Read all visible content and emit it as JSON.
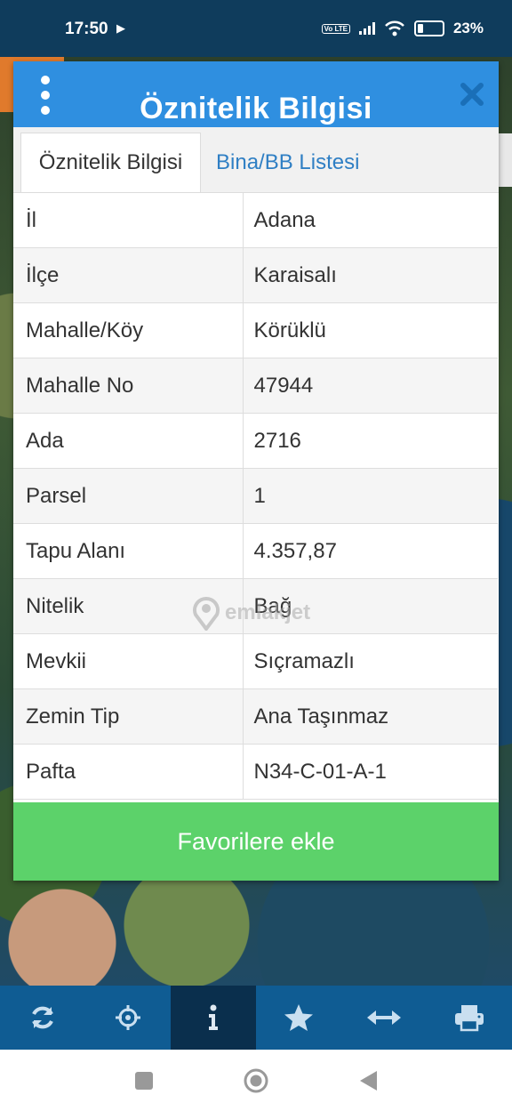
{
  "status_bar": {
    "time": "17:50",
    "volte_label": "Vo LTE",
    "battery_percent": "23%"
  },
  "modal": {
    "title": "Öznitelik Bilgisi",
    "tabs": [
      {
        "label": "Öznitelik Bilgisi",
        "active": true
      },
      {
        "label": "Bina/BB Listesi",
        "active": false
      }
    ],
    "rows": [
      {
        "key": "İl",
        "value": "Adana"
      },
      {
        "key": "İlçe",
        "value": "Karaisalı"
      },
      {
        "key": "Mahalle/Köy",
        "value": "Körüklü"
      },
      {
        "key": "Mahalle No",
        "value": "47944"
      },
      {
        "key": "Ada",
        "value": "2716"
      },
      {
        "key": "Parsel",
        "value": "1"
      },
      {
        "key": "Tapu Alanı",
        "value": "4.357,87"
      },
      {
        "key": "Nitelik",
        "value": "Bağ"
      },
      {
        "key": "Mevkii",
        "value": "Sıçramazlı"
      },
      {
        "key": "Zemin Tip",
        "value": "Ana Taşınmaz"
      },
      {
        "key": "Pafta",
        "value": "N34-C-01-A-1"
      }
    ],
    "favorite_button": "Favorilere ekle"
  },
  "watermark": "emlakjet",
  "toolbar": {
    "items": [
      {
        "icon": "refresh-icon",
        "active": false
      },
      {
        "icon": "locate-icon",
        "active": false
      },
      {
        "icon": "info-icon",
        "active": true
      },
      {
        "icon": "star-icon",
        "active": false
      },
      {
        "icon": "measure-arrows-icon",
        "active": false
      },
      {
        "icon": "print-icon",
        "active": false
      }
    ]
  },
  "colors": {
    "header_blue": "#2f8fe0",
    "toolbar_blue": "#0f5c93",
    "toolbar_active": "#0a2f4d",
    "favorite_green": "#5cd26a",
    "tab_link_blue": "#2f7fc4"
  }
}
